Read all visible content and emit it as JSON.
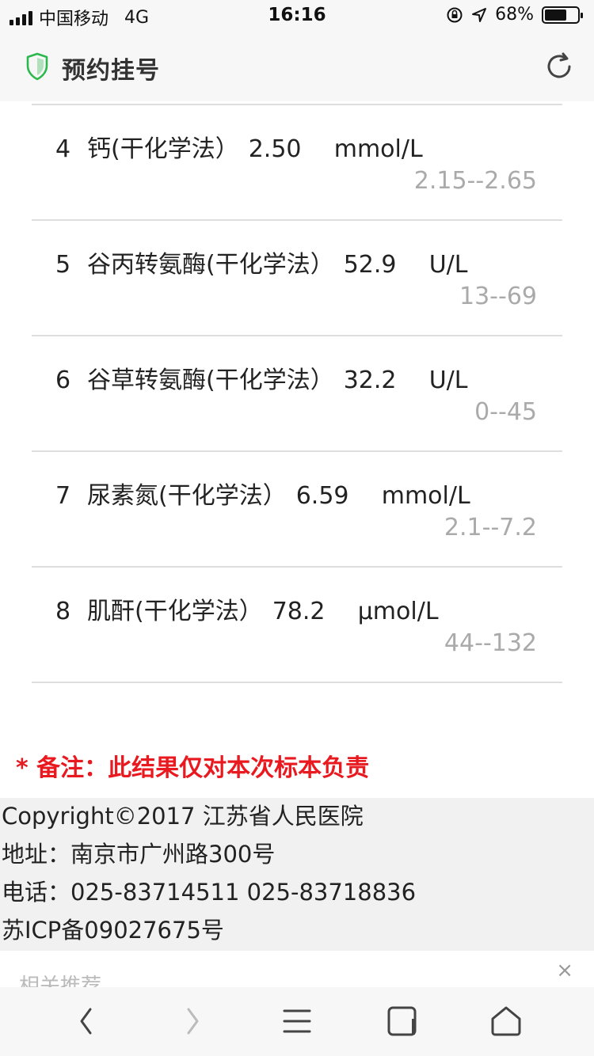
{
  "status_bar": {
    "carrier": "中国移动",
    "network": "4G",
    "time": "16:16",
    "battery_text": "68%",
    "battery_level": 0.68
  },
  "header": {
    "title": "预约挂号",
    "icons": [
      "shield-icon",
      "refresh-icon"
    ],
    "shield_color": "#2db84d"
  },
  "results": [
    {
      "index": "4",
      "name": "钙(干化学法）",
      "value": "2.50",
      "unit": "mmol/L",
      "range": "2.15--2.65"
    },
    {
      "index": "5",
      "name": "谷丙转氨酶(干化学法）",
      "value": "52.9",
      "unit": "U/L",
      "range": "13--69"
    },
    {
      "index": "6",
      "name": "谷草转氨酶(干化学法）",
      "value": "32.2",
      "unit": "U/L",
      "range": "0--45"
    },
    {
      "index": "7",
      "name": "尿素氮(干化学法）",
      "value": "6.59",
      "unit": "mmol/L",
      "range": "2.1--7.2"
    },
    {
      "index": "8",
      "name": "肌酐(干化学法）",
      "value": "78.2",
      "unit": "μmol/L",
      "range": "44--132"
    }
  ],
  "note": "* 备注：此结果仅对本次标本负责",
  "footer": {
    "copyright": "Copyright©2017 江苏省人民医院",
    "address": "地址：南京市广州路300号",
    "phone": "电话：025-83714511 025-83718836",
    "icp": "苏ICP备09027675号"
  },
  "recommend": {
    "label": "相关推荐",
    "close": "×"
  },
  "toolbar": {
    "icons": [
      "back-icon",
      "forward-icon",
      "menu-icon",
      "tabs-icon",
      "home-icon"
    ]
  },
  "colors": {
    "note_red": "#e8191f",
    "range_gray": "#aaaaaa",
    "footer_bg": "#f1f1f1"
  }
}
